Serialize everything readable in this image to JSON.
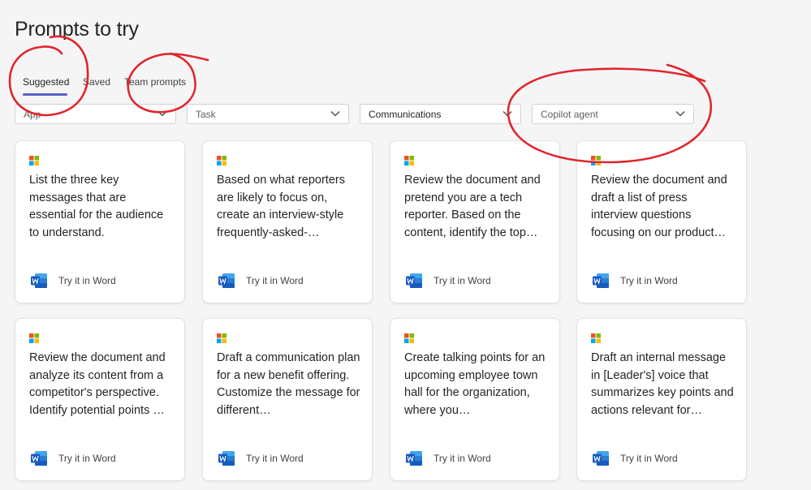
{
  "page_title": "Prompts to try",
  "tabs": [
    {
      "label": "Suggested",
      "active": true
    },
    {
      "label": "Saved",
      "active": false
    },
    {
      "label": "Team prompts",
      "active": false
    }
  ],
  "filters": {
    "app": {
      "placeholder": "App"
    },
    "task": {
      "placeholder": "Task"
    },
    "category": {
      "value": "Communications"
    },
    "agent": {
      "placeholder": "Copilot agent"
    }
  },
  "cards": [
    {
      "text": "List the three key messages that are essential for the audience to understand.",
      "action": "Try it in Word",
      "icon": "microsoft-logo-icon",
      "app_icon": "word-icon"
    },
    {
      "text": "Based on what reporters are likely to focus on, create an interview-style frequently-asked-…",
      "action": "Try it in Word",
      "icon": "microsoft-logo-icon",
      "app_icon": "word-icon"
    },
    {
      "text": "Review the document and pretend you are a tech reporter. Based on the content, identify the top…",
      "action": "Try it in Word",
      "icon": "microsoft-logo-icon",
      "app_icon": "word-icon"
    },
    {
      "text": "Review the document and draft a list of press interview questions focusing on our product…",
      "action": "Try it in Word",
      "icon": "microsoft-logo-icon",
      "app_icon": "word-icon"
    },
    {
      "text": "Review the document and analyze its content from a competitor's perspective. Identify potential points …",
      "action": "Try it in Word",
      "icon": "microsoft-logo-icon",
      "app_icon": "word-icon"
    },
    {
      "text": "Draft a communication plan for a new benefit offering. Customize the message for different…",
      "action": "Try it in Word",
      "icon": "microsoft-logo-icon",
      "app_icon": "word-icon"
    },
    {
      "text": "Create talking points for an upcoming employee town hall for the organization, where you…",
      "action": "Try it in Word",
      "icon": "microsoft-logo-icon",
      "app_icon": "word-icon"
    },
    {
      "text": "Draft an internal message in [Leader's] voice that summarizes key points and actions relevant for…",
      "action": "Try it in Word",
      "icon": "microsoft-logo-icon",
      "app_icon": "word-icon"
    }
  ],
  "colors": {
    "accent": "#5b5fc7",
    "annotation": "#e0262f",
    "word_blue": "#185abd"
  }
}
